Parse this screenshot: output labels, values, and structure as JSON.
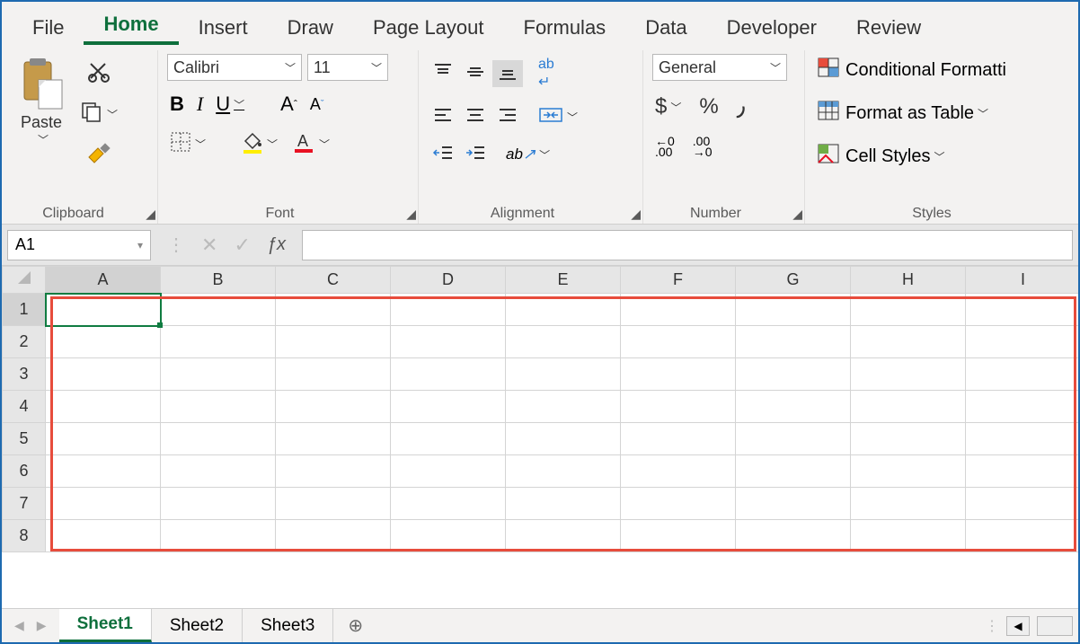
{
  "tabs": [
    "File",
    "Home",
    "Insert",
    "Draw",
    "Page Layout",
    "Formulas",
    "Data",
    "Developer",
    "Review"
  ],
  "active_tab": "Home",
  "ribbon": {
    "clipboard": {
      "label": "Clipboard",
      "paste": "Paste"
    },
    "font": {
      "label": "Font",
      "name": "Calibri",
      "size": "11",
      "bold": "B",
      "italic": "I",
      "underline": "U"
    },
    "alignment": {
      "label": "Alignment"
    },
    "number": {
      "label": "Number",
      "format": "General"
    },
    "styles": {
      "label": "Styles",
      "conditional": "Conditional Formatti",
      "table": "Format as Table",
      "cell": "Cell Styles"
    }
  },
  "formula_bar": {
    "name_box": "A1",
    "formula": ""
  },
  "columns": [
    "A",
    "B",
    "C",
    "D",
    "E",
    "F",
    "G",
    "H",
    "I"
  ],
  "rows": [
    "1",
    "2",
    "3",
    "4",
    "5",
    "6",
    "7",
    "8"
  ],
  "selected_cell": "A1",
  "sheets": [
    "Sheet1",
    "Sheet2",
    "Sheet3"
  ],
  "active_sheet": "Sheet1"
}
